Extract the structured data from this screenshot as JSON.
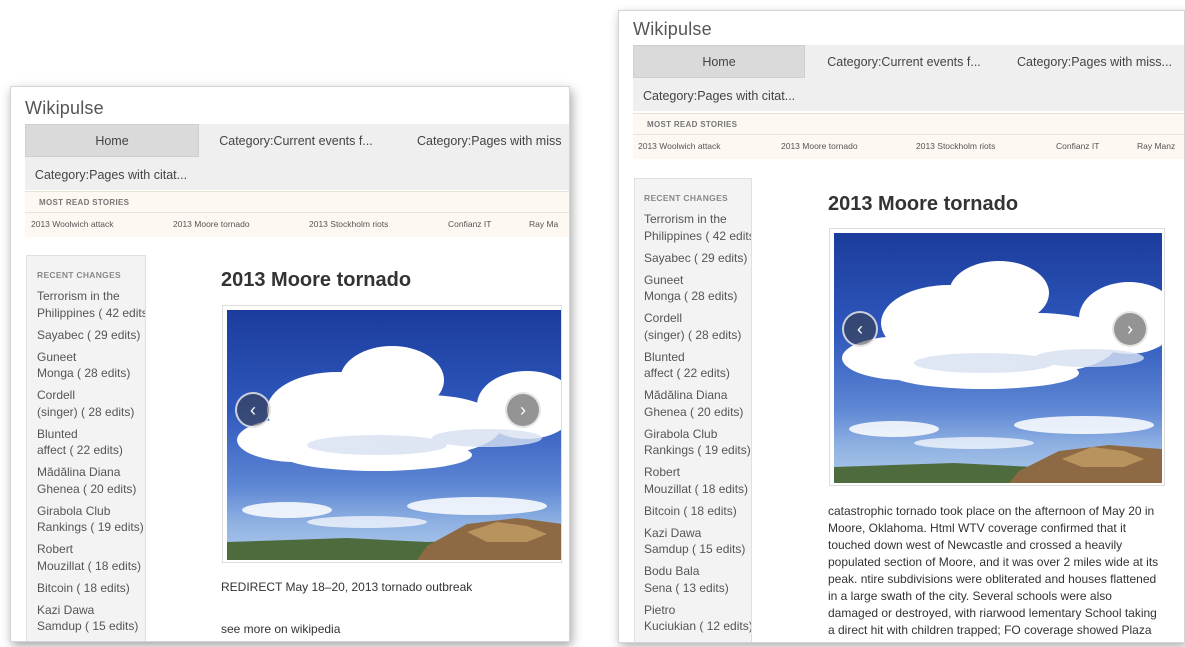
{
  "brand": "Wikipulse",
  "nav": {
    "home": "Home",
    "current_events": "Category:Current events f...",
    "pages_missing_left": "Category:Pages with miss",
    "pages_missing_right": "Category:Pages with miss...",
    "pages_citation": "Category:Pages with citat..."
  },
  "most_read": {
    "header": "MOST READ STORIES",
    "items": [
      "2013 Woolwich attack",
      "2013 Moore tornado",
      "2013 Stockholm riots",
      "Confianz IT",
      "Ray Ma",
      "Ray Manz"
    ]
  },
  "recent_changes": {
    "header": "RECENT CHANGES",
    "items": [
      [
        "Terrorism in the",
        "Philippines ( 42 edits)"
      ],
      [
        "Sayabec ( 29 edits)"
      ],
      [
        "Guneet",
        "Monga ( 28 edits)"
      ],
      [
        "Cordell",
        "(singer) ( 28 edits)"
      ],
      [
        "Blunted",
        "affect ( 22 edits)"
      ],
      [
        "Mădălina Diana",
        "Ghenea ( 20 edits)"
      ],
      [
        "Girabola Club",
        "Rankings ( 19 edits)"
      ],
      [
        "Robert",
        "Mouzillat ( 18 edits)"
      ],
      [
        "Bitcoin ( 18 edits)"
      ],
      [
        "Kazi Dawa",
        "Samdup ( 15 edits)"
      ],
      [
        "Bodu Bala",
        "Sena ( 13 edits)"
      ],
      [
        "Pietro",
        "Kuciukian ( 12 edits)"
      ]
    ]
  },
  "article": {
    "title": "2013 Moore tornado",
    "redirect": "REDIRECT May 18–20, 2013 tornado outbreak",
    "see_more": "see more on wikipedia",
    "summary": "catastrophic tornado took place on the afternoon of May 20 in Moore, Oklahoma. Html WTV coverage confirmed that it touched down west of Newcastle and crossed a heavily populated section of Moore, and it was over 2 miles wide at its peak. ntire subdivisions were obliterated and houses flattened in a large swath of the city. Several schools were also damaged or destroyed, with riarwood lementary School taking a direct hit with children trapped; FO coverage showed Plaza"
  },
  "carousel": {
    "prev": "‹",
    "next": "›"
  }
}
